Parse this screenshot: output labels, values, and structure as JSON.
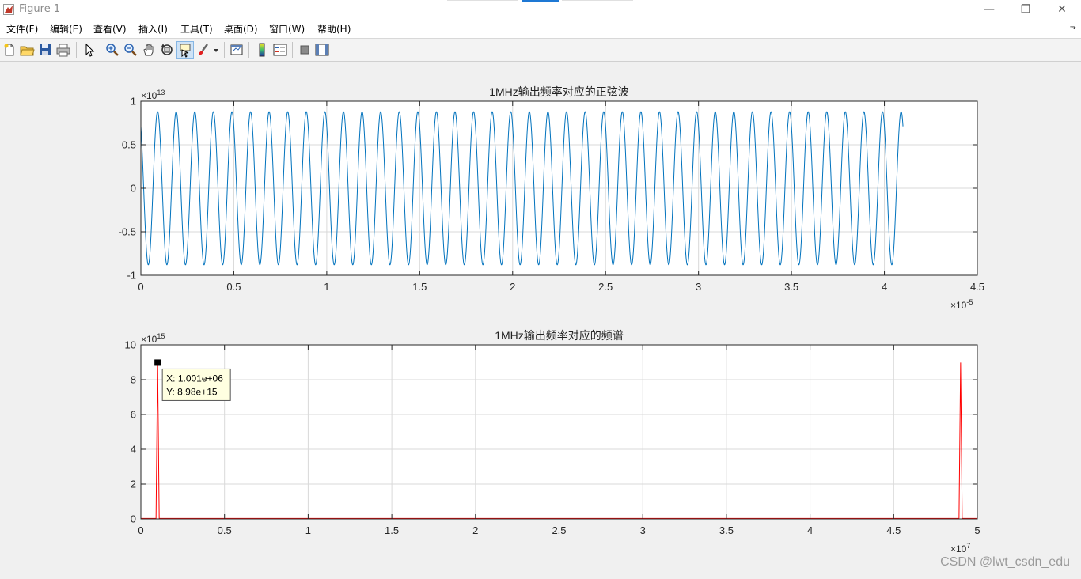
{
  "window": {
    "title": "Figure 1",
    "controls": {
      "minimize": "—",
      "restore": "❐",
      "close": "✕"
    }
  },
  "menu": {
    "items": [
      "文件(F)",
      "编辑(E)",
      "查看(V)",
      "插入(I)",
      "工具(T)",
      "桌面(D)",
      "窗口(W)",
      "帮助(H)"
    ],
    "overflow_icon": "⬎"
  },
  "toolbar": {
    "icons": [
      "new-figure-icon",
      "open-file-icon",
      "save-icon",
      "print-icon",
      "select-arrow-icon",
      "zoom-in-icon",
      "zoom-out-icon",
      "pan-hand-icon",
      "rotate-3d-icon",
      "data-cursor-icon",
      "brush-icon",
      "brush-dropdown-icon",
      "link-plot-icon",
      "colorbar-icon",
      "legend-icon",
      "hide-plot-tools-icon",
      "show-plot-tools-icon"
    ]
  },
  "colors": {
    "sine": "#0072bd",
    "spectrum": "#ff0000",
    "grid": "#d9d9d9"
  },
  "chart_data": [
    {
      "type": "line",
      "title": "1MHz输出频率对应的正弦波",
      "series_color": "#0072bd",
      "xlim": [
        0,
        4.5
      ],
      "ylim": [
        -1,
        1
      ],
      "x_ticks": [
        "0",
        "0.5",
        "1",
        "1.5",
        "2",
        "2.5",
        "3",
        "3.5",
        "4",
        "4.5"
      ],
      "y_ticks": [
        "-1",
        "-0.5",
        "0",
        "0.5",
        "1"
      ],
      "x_exponent": {
        "base": "×10",
        "power": "-5"
      },
      "y_exponent": {
        "base": "×10",
        "power": "13"
      },
      "signal": {
        "frequency_cycles_per_unit": 10,
        "amplitude": 0.88,
        "phase_offset": 0.09,
        "x_end": 4.1
      },
      "grid": true
    },
    {
      "type": "line",
      "title": "1MHz输出频率对应的频谱",
      "series_color": "#ff0000",
      "xlim": [
        0,
        5
      ],
      "ylim": [
        0,
        10
      ],
      "x_ticks": [
        "0",
        "0.5",
        "1",
        "1.5",
        "2",
        "2.5",
        "3",
        "3.5",
        "4",
        "4.5",
        "5"
      ],
      "y_ticks": [
        "0",
        "2",
        "4",
        "6",
        "8",
        "10"
      ],
      "x_exponent": {
        "base": "×10",
        "power": "7"
      },
      "y_exponent": {
        "base": "×10",
        "power": "15"
      },
      "peaks": [
        {
          "x": 0.1001,
          "y": 8.98
        },
        {
          "x": 4.9,
          "y": 8.98
        }
      ],
      "datatip": {
        "x": 0.1001,
        "y": 8.98,
        "x_text": "X: 1.001e+06",
        "y_text": "Y: 8.98e+15"
      },
      "grid": true
    }
  ],
  "watermark": "CSDN @lwt_csdn_edu"
}
